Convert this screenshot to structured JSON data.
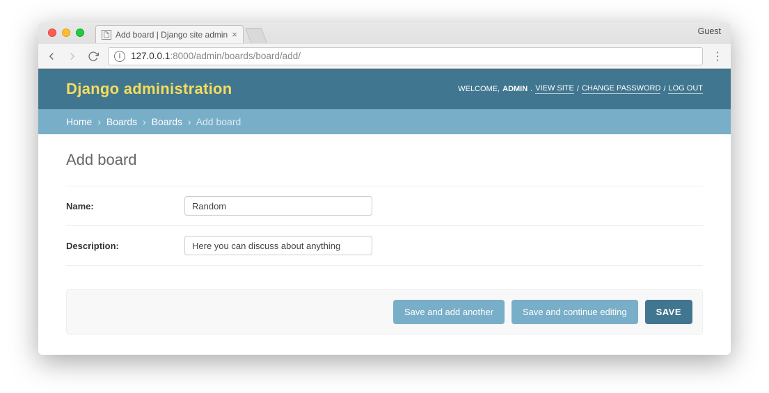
{
  "browser": {
    "guest_label": "Guest",
    "tab_title": "Add board | Django site admin",
    "url_host": "127.0.0.1",
    "url_port_path": ":8000/admin/boards/board/add/"
  },
  "header": {
    "branding": "Django administration",
    "welcome": "WELCOME,",
    "username": "ADMIN",
    "view_site": "VIEW SITE",
    "change_password": "CHANGE PASSWORD",
    "log_out": "LOG OUT",
    "dot": ".",
    "slash": "/"
  },
  "breadcrumbs": {
    "items": [
      "Home",
      "Boards",
      "Boards"
    ],
    "current": "Add board",
    "sep": "›"
  },
  "page": {
    "title": "Add board"
  },
  "form": {
    "rows": [
      {
        "label": "Name:",
        "value": "Random"
      },
      {
        "label": "Description:",
        "value": "Here you can discuss about anything"
      }
    ]
  },
  "submit": {
    "save_add_another": "Save and add another",
    "save_continue": "Save and continue editing",
    "save": "SAVE"
  }
}
